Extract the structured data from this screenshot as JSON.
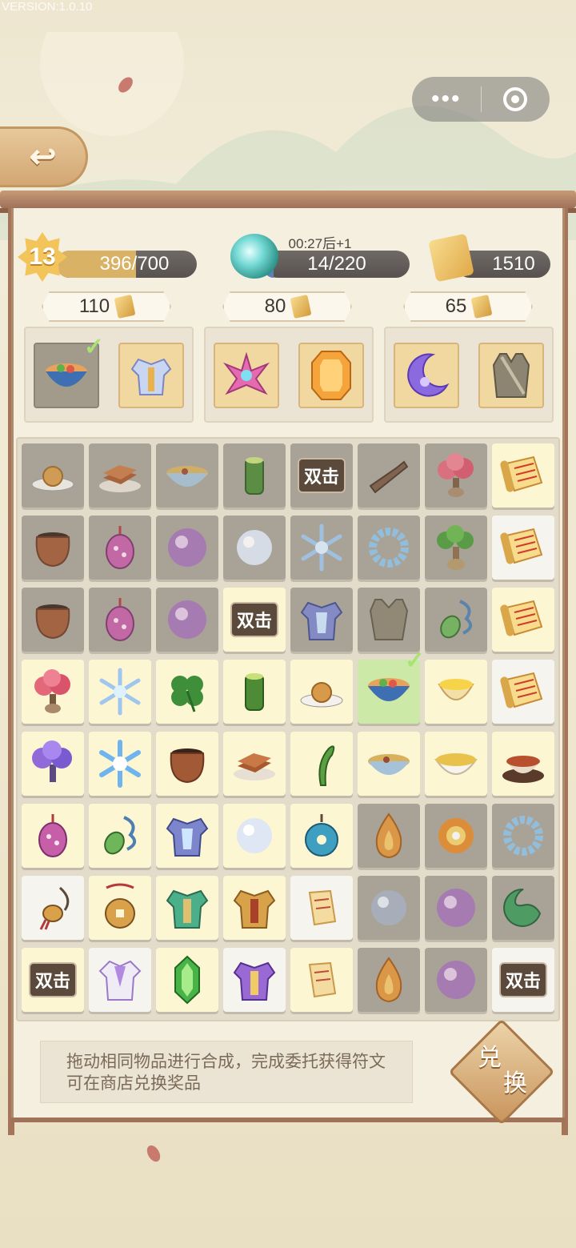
{
  "version_label": "VERSION:1.0.10",
  "capsule": {
    "more_label": "•••",
    "exit_icon": "target-icon"
  },
  "back_icon": "swirl-back-icon",
  "stats": {
    "level": "13",
    "exp_text": "396/700",
    "exp_progress": 0.566,
    "timer_text": "00:27后+1",
    "energy_text": "14/220",
    "energy_progress": 0.064,
    "scroll_count": "1510"
  },
  "orders": [
    {
      "cost": "110",
      "items": [
        {
          "icon": "noodle-bowl-icon",
          "done": true
        },
        {
          "icon": "silver-armor-icon",
          "done": false
        }
      ]
    },
    {
      "cost": "80",
      "items": [
        {
          "icon": "pink-lotus-icon",
          "done": false
        },
        {
          "icon": "amber-gem-icon",
          "done": false
        }
      ]
    },
    {
      "cost": "65",
      "items": [
        {
          "icon": "crescent-moon-icon",
          "done": false
        },
        {
          "icon": "leather-vest-icon",
          "done": false
        }
      ]
    }
  ],
  "double_label": "双击",
  "grid": [
    [
      "mooncake-lock",
      "tofu-lock",
      "soup-lock",
      "bamboo-lock",
      "double-lock",
      "branch-lock",
      "pink-tree-lock",
      "scroll-open"
    ],
    [
      "pot-lock",
      "pink-pouch-lock",
      "pearl-lock",
      "white-pearl-lock",
      "snowflake-lock",
      "wreath-lock",
      "green-tree-lock",
      "scroll-white"
    ],
    [
      "pot-lock",
      "pink-pouch-lock",
      "pearl-lock",
      "double-open",
      "blue-armor-lock",
      "vest-lock",
      "jade-pendant-lock",
      "scroll-open"
    ],
    [
      "pink-tree-open",
      "snowflake-open",
      "clover-open",
      "bamboo-open",
      "mooncake-open",
      "noodle-sel",
      "egg-custard-open",
      "scroll-white"
    ],
    [
      "purple-tree-open",
      "snowflake-blue-open",
      "pot-open",
      "tofu-open",
      "sprout-open",
      "soup-open",
      "white-bowl-open",
      "red-bowl-open"
    ],
    [
      "pink-pouch-open",
      "jade-pendant-open",
      "blue-armor-open",
      "white-pearl-open",
      "blue-pendant-open",
      "fire-lock",
      "fire-swirl-lock",
      "wreath-lock"
    ],
    [
      "tassel-white",
      "coin-amulet-open",
      "green-armor-open",
      "gold-armor-open",
      "scroll-small-white",
      "grey-pearl-lock",
      "pearl-lock",
      "jade-swirl-lock"
    ],
    [
      "double-open",
      "purple-robe-white",
      "green-crystal-open",
      "purple-armor-white",
      "scroll-small-open",
      "fire-lock",
      "pearl-lock",
      "double-white"
    ]
  ],
  "hint_text": "拖动相同物品进行合成，完成委托获得符文可在商店兑换奖品",
  "redeem_label_1": "兑",
  "redeem_label_2": "换",
  "colors": {
    "exp_fill": "#d9b266",
    "energy_fill": "#5e7fb7",
    "board": "#f5efdf",
    "locked_cell": "#a9a397",
    "open_cell": "#fdf6d2"
  }
}
